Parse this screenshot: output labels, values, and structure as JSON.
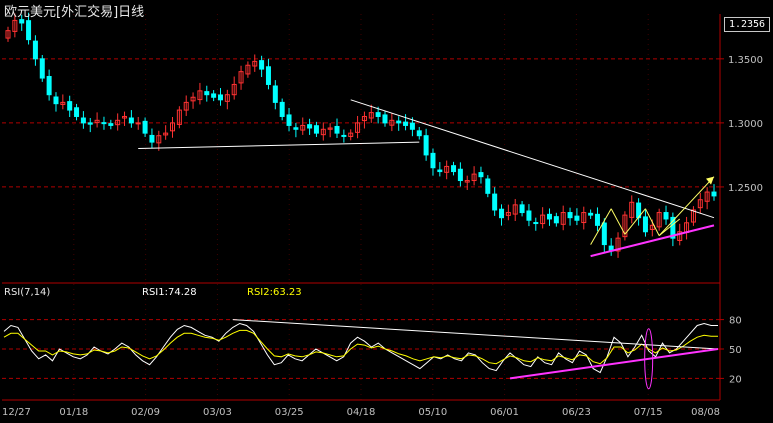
{
  "title": "欧元美元[外汇交易]日线",
  "last_price": "1.2356",
  "indicator": {
    "name": "RSI(7,14)",
    "rsi1_label": "RSI1:74.28",
    "rsi2_label": "RSI2:63.23"
  },
  "colors": {
    "background": "#000000",
    "up_candle": "#ff3232",
    "down_candle": "#00ffff",
    "grid": "#b00000",
    "axis_text": "#c0c0c0",
    "rsi1_line": "#ffffff",
    "rsi2_line": "#ffff00",
    "trendline_white": "#ffffff",
    "trendline_yellow": "#ffff66",
    "trendline_magenta": "#ff33ff"
  },
  "chart_data": [
    {
      "type": "candlestick",
      "title": "欧元美元[外汇交易]日线",
      "y_ticks": [
        "1.3500",
        "1.3000",
        "1.2500"
      ],
      "ylim": [
        1.175,
        1.385
      ],
      "x_ticks": [
        "12/27",
        "01/18",
        "02/09",
        "03/03",
        "03/25",
        "04/18",
        "05/10",
        "06/01",
        "06/23",
        "07/15",
        "08/08"
      ],
      "grid": "horizontal dashed",
      "approx_close_path": [
        1.372,
        1.38,
        1.378,
        1.365,
        1.35,
        1.335,
        1.322,
        1.315,
        1.316,
        1.31,
        1.305,
        1.3,
        1.299,
        1.302,
        1.3,
        1.298,
        1.302,
        1.305,
        1.3,
        1.3,
        1.292,
        1.285,
        1.29,
        1.292,
        1.3,
        1.31,
        1.316,
        1.32,
        1.325,
        1.322,
        1.32,
        1.318,
        1.322,
        1.33,
        1.34,
        1.345,
        1.348,
        1.342,
        1.33,
        1.316,
        1.305,
        1.298,
        1.295,
        1.298,
        1.296,
        1.292,
        1.295,
        1.296,
        1.292,
        1.29,
        1.292,
        1.3,
        1.305,
        1.308,
        1.305,
        1.3,
        1.302,
        1.3,
        1.298,
        1.295,
        1.29,
        1.275,
        1.265,
        1.262,
        1.266,
        1.262,
        1.255,
        1.255,
        1.26,
        1.258,
        1.245,
        1.232,
        1.226,
        1.23,
        1.236,
        1.23,
        1.224,
        1.222,
        1.228,
        1.225,
        1.222,
        1.23,
        1.226,
        1.224,
        1.23,
        1.228,
        1.22,
        1.205,
        1.2,
        1.21,
        1.228,
        1.238,
        1.226,
        1.215,
        1.22,
        1.23,
        1.225,
        1.21,
        1.215,
        1.222,
        1.232,
        1.24,
        1.246,
        1.243
      ],
      "annotations": [
        "upper descending trendline (white)",
        "support line (white)",
        "triangle/channel breakout lines (yellow)",
        "lower support line (magenta)",
        "arrow indicating upward breakout (yellow)"
      ]
    },
    {
      "type": "line",
      "title": "RSI(7,14)",
      "y_ticks": [
        "80",
        "50",
        "20"
      ],
      "ylim": [
        0,
        100
      ],
      "series": [
        {
          "name": "RSI1",
          "values": [
            68,
            74,
            72,
            60,
            48,
            40,
            44,
            38,
            50,
            46,
            42,
            40,
            44,
            52,
            48,
            45,
            50,
            56,
            52,
            44,
            38,
            34,
            42,
            52,
            62,
            70,
            74,
            72,
            68,
            64,
            62,
            58,
            66,
            72,
            76,
            74,
            68,
            56,
            44,
            34,
            36,
            44,
            40,
            38,
            44,
            50,
            46,
            42,
            38,
            42,
            56,
            62,
            58,
            52,
            56,
            50,
            46,
            42,
            38,
            34,
            30,
            36,
            42,
            40,
            44,
            40,
            38,
            46,
            44,
            36,
            30,
            28,
            38,
            46,
            40,
            34,
            32,
            42,
            36,
            34,
            46,
            40,
            36,
            48,
            44,
            30,
            26,
            42,
            62,
            56,
            42,
            52,
            64,
            48,
            42,
            56,
            46,
            50,
            58,
            66,
            74,
            76,
            74,
            74
          ]
        },
        {
          "name": "RSI2",
          "values": [
            62,
            66,
            66,
            60,
            54,
            48,
            48,
            44,
            48,
            47,
            45,
            44,
            45,
            49,
            48,
            46,
            48,
            52,
            51,
            47,
            43,
            40,
            43,
            49,
            56,
            62,
            66,
            66,
            64,
            62,
            61,
            59,
            62,
            66,
            69,
            69,
            66,
            58,
            50,
            43,
            42,
            45,
            43,
            42,
            44,
            47,
            46,
            44,
            42,
            43,
            50,
            55,
            54,
            51,
            53,
            50,
            48,
            45,
            43,
            40,
            38,
            40,
            42,
            41,
            43,
            41,
            40,
            44,
            43,
            40,
            36,
            35,
            39,
            43,
            41,
            38,
            37,
            41,
            39,
            38,
            43,
            41,
            39,
            44,
            43,
            37,
            35,
            41,
            52,
            52,
            46,
            49,
            55,
            50,
            46,
            51,
            48,
            49,
            53,
            58,
            62,
            64,
            63,
            63
          ]
        }
      ]
    }
  ]
}
